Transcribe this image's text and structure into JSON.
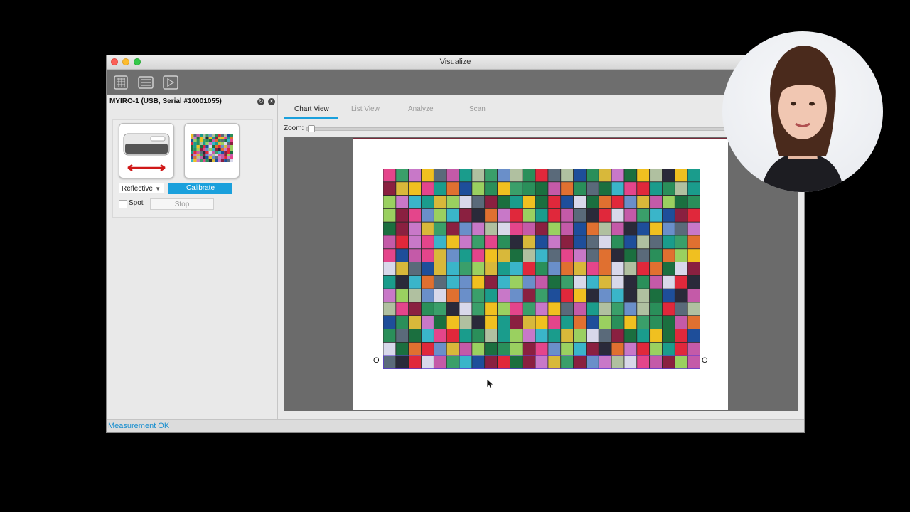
{
  "window": {
    "title": "Visualize"
  },
  "toolbar": {
    "icons": [
      "chart-view-tool-icon",
      "list-tool-icon",
      "scan-tool-icon"
    ]
  },
  "device": {
    "name": "MYIRO-1 (USB, Serial #10001055)",
    "mode_select": "Reflective",
    "calibrate_label": "Calibrate",
    "spot_label": "Spot",
    "stop_label": "Stop"
  },
  "tabs": [
    {
      "label": "Chart View",
      "active": true
    },
    {
      "label": "List View",
      "active": false
    },
    {
      "label": "Analyze",
      "active": false
    },
    {
      "label": "Scan",
      "active": false
    }
  ],
  "zoom": {
    "label": "Zoom:"
  },
  "chart": {
    "markers": [
      "O",
      "O"
    ],
    "columns": 25,
    "rows": 15,
    "palette": [
      "#e4458b",
      "#2a8f5a",
      "#d8b83a",
      "#1b6f3f",
      "#3ab5c9",
      "#e0283b",
      "#6a8fc9",
      "#c45aa8",
      "#3a9f6a",
      "#1e4e9a",
      "#f0c020",
      "#5a6a7a",
      "#1a9c8c",
      "#e07030",
      "#9ad060",
      "#d8d8ea",
      "#8a2040",
      "#2a2a3a",
      "#c878c8",
      "#b0c0a0"
    ]
  },
  "status": {
    "text": "Measurement OK",
    "color": "#1a8fcf"
  }
}
